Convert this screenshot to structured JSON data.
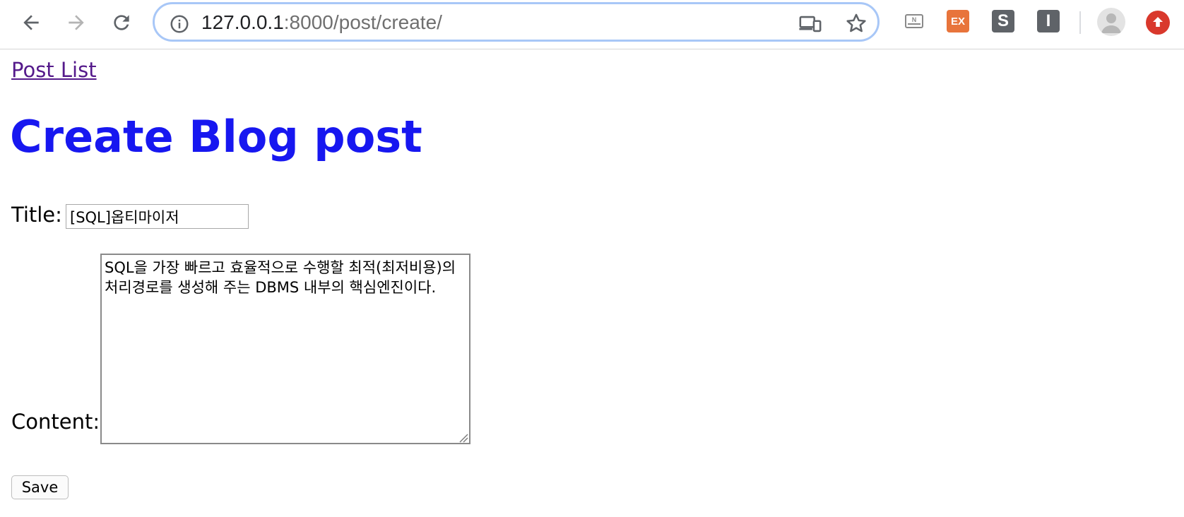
{
  "browser": {
    "url_host": "127.0.0.1",
    "url_rest": ":8000/post/create/",
    "extensions": [
      {
        "name": "naver-extension-icon",
        "label": "N",
        "color": "#9e9e9e"
      },
      {
        "name": "ex-extension-icon",
        "label": "EX",
        "color": "#e8743b"
      },
      {
        "name": "s-extension-icon",
        "label": "S",
        "color": "#5f6368"
      },
      {
        "name": "i-extension-icon",
        "label": "I",
        "color": "#5f6368"
      }
    ],
    "update_color": "#d9382c"
  },
  "page": {
    "post_list_link": "Post List",
    "title": "Create Blog post",
    "form": {
      "title_label": "Title:",
      "title_value": "[SQL]옵티마이저",
      "content_label": "Content:",
      "content_value": "SQL을 가장 빠르고 효율적으로 수행할 최적(최저비용)의 처리경로를 생성해 주는 DBMS 내부의 핵심엔진이다.",
      "save_label": "Save"
    }
  },
  "colors": {
    "title": "#1717f0",
    "link_visited": "#551a8b",
    "omnibox_focus": "#a8c7f7"
  }
}
